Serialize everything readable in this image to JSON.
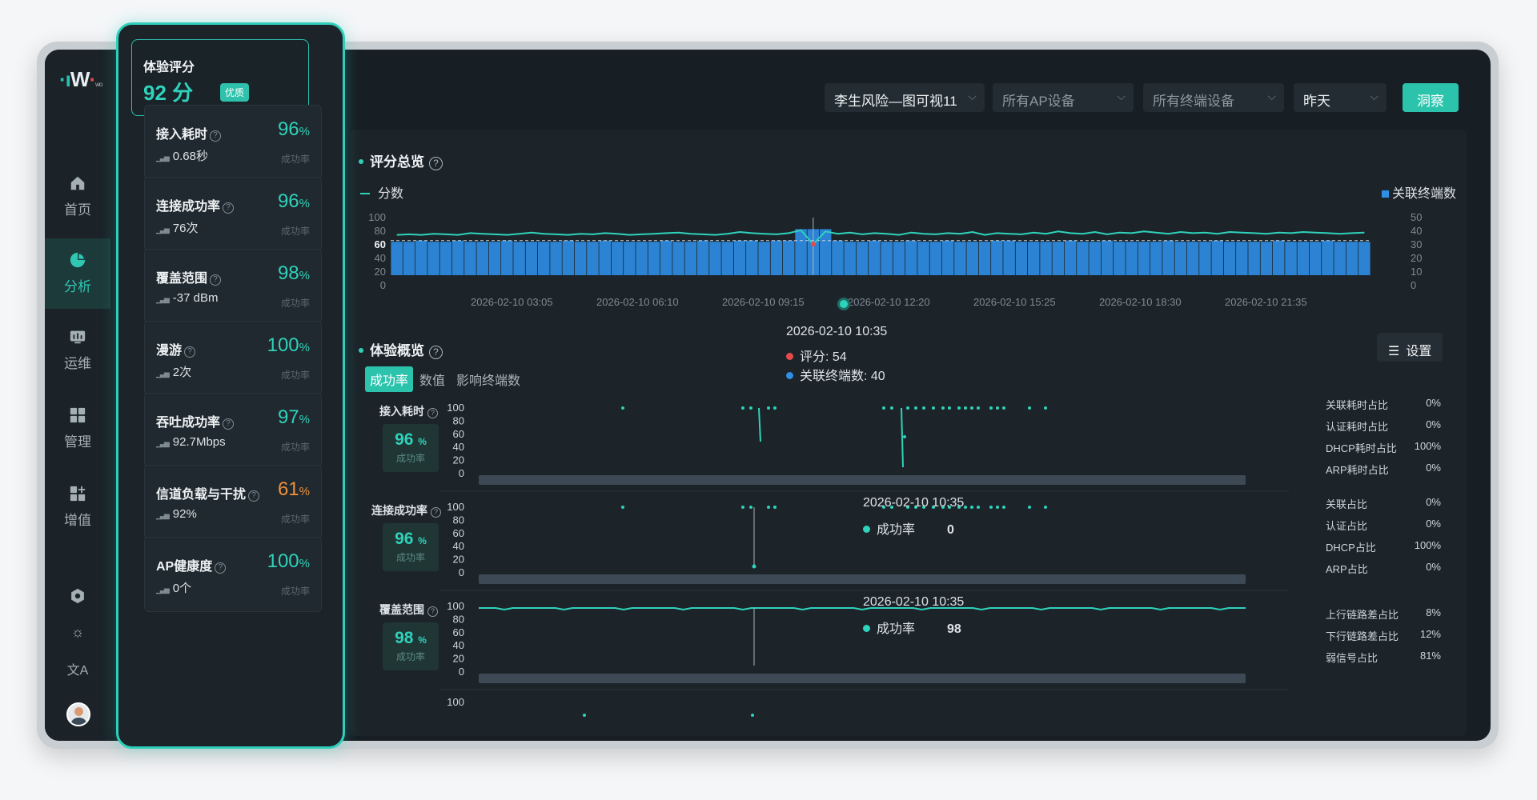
{
  "app": {
    "logo_text": "W",
    "logo_sub": "wo"
  },
  "nav": {
    "items": [
      {
        "label": "首页",
        "icon": "home-icon"
      },
      {
        "label": "分析",
        "icon": "pie-chart-icon",
        "active": true
      },
      {
        "label": "运维",
        "icon": "monitor-icon"
      },
      {
        "label": "管理",
        "icon": "grid-icon"
      },
      {
        "label": "增值",
        "icon": "apps-add-icon"
      }
    ],
    "bottom_icons": [
      "settings-icon",
      "theme-icon",
      "language-icon",
      "avatar"
    ],
    "lang_glyph": "文A",
    "theme_glyph": "☼"
  },
  "score_panel": {
    "title": "体验评分",
    "score": "92 分",
    "badge": "优质",
    "metrics": [
      {
        "name": "接入耗时",
        "pct": "96",
        "sub": "0.68秒",
        "rate": "成功率"
      },
      {
        "name": "连接成功率",
        "pct": "96",
        "sub": "76次",
        "rate": "成功率"
      },
      {
        "name": "覆盖范围",
        "pct": "98",
        "sub": "-37 dBm",
        "rate": "成功率"
      },
      {
        "name": "漫游",
        "pct": "100",
        "sub": "2次",
        "rate": "成功率"
      },
      {
        "name": "吞吐成功率",
        "pct": "97",
        "sub": "92.7Mbps",
        "rate": "成功率"
      },
      {
        "name": "信道负载与干扰",
        "pct": "61",
        "sub": "92%",
        "rate": "成功率",
        "warn": true
      },
      {
        "name": "AP健康度",
        "pct": "100",
        "sub": "0个",
        "rate": "成功率"
      }
    ],
    "pct_unit": "%"
  },
  "filters": {
    "site": "李生风险—图可视11",
    "ap": "所有AP设备",
    "terminal": "所有终端设备",
    "date": "昨天",
    "action": "洞察"
  },
  "overview": {
    "title": "评分总览",
    "legend_score": "分数",
    "legend_terminals": "关联终端数",
    "left_axis": [
      "100",
      "80",
      "60",
      "40",
      "20",
      "0"
    ],
    "right_axis": [
      "50",
      "40",
      "30",
      "20",
      "10",
      "0"
    ],
    "x_ticks": [
      "2026-02-10 03:05",
      "2026-02-10 06:10",
      "2026-02-10 09:15",
      "2026-02-10 12:20",
      "2026-02-10 15:25",
      "2026-02-10 18:30",
      "2026-02-10 21:35"
    ],
    "tooltip": {
      "time": "2026-02-10 10:35",
      "score_label": "评分: 54",
      "terminals_label": "关联终端数: 40"
    }
  },
  "experience": {
    "title": "体验概览",
    "settings": "设置",
    "tabs": [
      "成功率",
      "数值",
      "影响终端数"
    ],
    "y_ticks": [
      "100",
      "80",
      "60",
      "40",
      "20",
      "0"
    ],
    "rows": [
      {
        "label": "接入耗时",
        "kpi": "96",
        "kpi_unit": "%",
        "kpi_sub": "成功率",
        "ratios": [
          [
            "关联耗时占比",
            "0%"
          ],
          [
            "认证耗时占比",
            "0%"
          ],
          [
            "DHCP耗时占比",
            "100%"
          ],
          [
            "ARP耗时占比",
            "0%"
          ]
        ]
      },
      {
        "label": "连接成功率",
        "kpi": "96",
        "kpi_unit": "%",
        "kpi_sub": "成功率",
        "tooltip_time": "2026-02-10 10:35",
        "tooltip_label": "成功率",
        "tooltip_value": "0",
        "ratios": [
          [
            "关联占比",
            "0%"
          ],
          [
            "认证占比",
            "0%"
          ],
          [
            "DHCP占比",
            "100%"
          ],
          [
            "ARP占比",
            "0%"
          ]
        ]
      },
      {
        "label": "覆盖范围",
        "kpi": "98",
        "kpi_unit": "%",
        "kpi_sub": "成功率",
        "tooltip_time": "2026-02-10 10:35",
        "tooltip_label": "成功率",
        "tooltip_value": "98",
        "ratios": [
          [
            "上行链路差占比",
            "8%"
          ],
          [
            "下行链路差占比",
            "12%"
          ],
          [
            "弱信号占比",
            "81%"
          ]
        ]
      }
    ],
    "last_row_tick": "100"
  },
  "colors": {
    "accent": "#2fd2bb",
    "bar": "#2f8ee6",
    "warn": "#f0903a",
    "tooltip_red": "#e84a4a"
  },
  "chart_data": {
    "type": "bar",
    "title": "评分总览",
    "series": [
      {
        "name": "分数",
        "type": "line",
        "y_axis": "left",
        "values": [
          70,
          71,
          70,
          72,
          71,
          70,
          73,
          72,
          71,
          70,
          72,
          74,
          72,
          71,
          70,
          72,
          71,
          73,
          72,
          70,
          71,
          72,
          73,
          74,
          72,
          71,
          70,
          72,
          75,
          73,
          72,
          71,
          73,
          78,
          54,
          76,
          72,
          74,
          71,
          73,
          72,
          70,
          74,
          72,
          71,
          73,
          72,
          75,
          70,
          73,
          72,
          71,
          74,
          72,
          76,
          73,
          72,
          75,
          71,
          74,
          73,
          76,
          74,
          72,
          75,
          73,
          74,
          72,
          75,
          74,
          73,
          72,
          74,
          73,
          75,
          74,
          73,
          72,
          73,
          74
        ]
      },
      {
        "name": "关联终端数",
        "type": "bar",
        "y_axis": "right",
        "values": [
          29,
          29,
          30,
          29,
          29,
          30,
          29,
          29,
          29,
          30,
          29,
          29,
          29,
          29,
          30,
          29,
          29,
          30,
          29,
          29,
          29,
          29,
          30,
          29,
          29,
          30,
          29,
          29,
          30,
          30,
          29,
          30,
          30,
          40,
          40,
          40,
          30,
          29,
          29,
          30,
          29,
          29,
          30,
          29,
          29,
          30,
          29,
          29,
          29,
          30,
          30,
          29,
          29,
          29,
          29,
          30,
          29,
          29,
          30,
          29,
          29,
          29,
          29,
          30,
          29,
          29,
          29,
          30,
          29,
          29,
          29,
          29,
          30,
          29,
          29,
          29,
          30,
          29,
          29,
          29
        ]
      }
    ],
    "y_left_range": [
      0,
      100
    ],
    "y_right_range": [
      0,
      50
    ],
    "reference_line": 60
  }
}
